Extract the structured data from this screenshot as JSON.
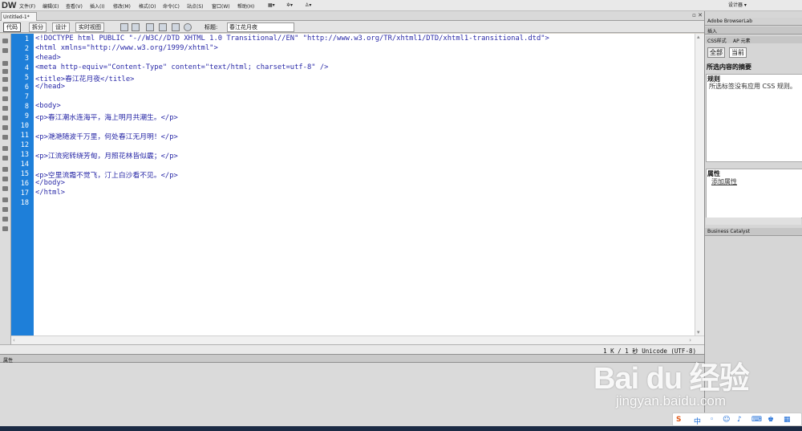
{
  "app": {
    "logo": "DW",
    "document_tab": "Untitled-1*",
    "designer": "设计器 ▾"
  },
  "menu": [
    "文件(F)",
    "编辑(E)",
    "查看(V)",
    "插入(I)",
    "修改(M)",
    "格式(O)",
    "命令(C)",
    "站点(S)",
    "窗口(W)",
    "帮助(H)"
  ],
  "toolbar": {
    "views": [
      "代码",
      "拆分",
      "设计",
      "实时视图"
    ],
    "title_label": "标题:",
    "title_value": "春江花月夜"
  },
  "code_lines": [
    "<!DOCTYPE html PUBLIC \"-//W3C//DTD XHTML 1.0 Transitional//EN\" \"http://www.w3.org/TR/xhtml1/DTD/xhtml1-transitional.dtd\">",
    "<html xmlns=\"http://www.w3.org/1999/xhtml\">",
    "<head>",
    "<meta http-equiv=\"Content-Type\" content=\"text/html; charset=utf-8\" />",
    "<title>春江花月夜</title>",
    "</head>",
    "",
    "<body>",
    "<p>春江潮水连海平，海上明月共潮生。</p>",
    "",
    "<p>滟滟随波千万里，何处春江无月明！</p>",
    "",
    "<p>江流宛转绕芳甸，月照花林皆似霰；</p>",
    "",
    "<p>空里流霜不觉飞，汀上白沙看不见。</p>",
    "</body>",
    "</html>",
    ""
  ],
  "line_numbers": [
    "1",
    "2",
    "3",
    "4",
    "5",
    "6",
    "7",
    "8",
    "9",
    "10",
    "11",
    "12",
    "13",
    "14",
    "15",
    "16",
    "17",
    "18"
  ],
  "status": {
    "text": "1 K / 1 秒 Unicode (UTF-8)"
  },
  "properties": {
    "label": "属性"
  },
  "right_panel": {
    "browserlab": "Adobe BrowserLab",
    "insert": "插入",
    "css_tabs": [
      "CSS样式",
      "AP 元素"
    ],
    "mode_buttons": [
      "全部",
      "当前"
    ],
    "summary_title": "所选内容的摘要",
    "rules_title": "规则",
    "rules_text": "所选标签没有应用 CSS 规则。",
    "props_title": "属性",
    "add_property": "添加属性",
    "business_catalyst": "Business Catalyst"
  },
  "watermark": {
    "brand": "Bai du 经验",
    "url": "jingyan.baidu.com"
  },
  "colors": {
    "gutter": "#1e7fd9",
    "code_text": "#2a2aa8"
  }
}
